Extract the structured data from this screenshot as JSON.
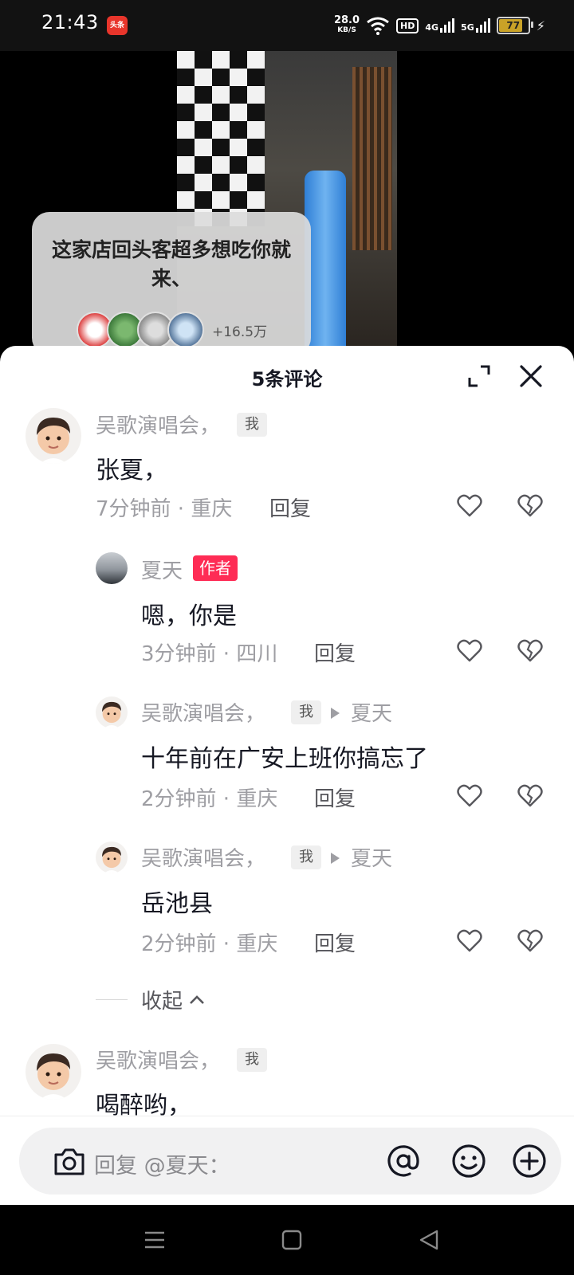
{
  "status_bar": {
    "time": "21:43",
    "app_badge": "头条",
    "net_speed": "28.0",
    "net_unit": "KB/S",
    "hd": "HD",
    "sig1": "4G",
    "sig2": "5G",
    "battery": "77",
    "battery_level": 0.77
  },
  "video": {
    "promo_text": "这家店回头客超多想吃你就来、",
    "promo_count": "+16.5万"
  },
  "sheet": {
    "title": "5条评论"
  },
  "comments": [
    {
      "user": "吴歌演唱会，",
      "badge": "我",
      "text": "张夏，",
      "meta": "7分钟前 · 重庆",
      "reply": "回复"
    },
    {
      "user": "夏天",
      "badge": "作者",
      "text": "嗯，你是",
      "meta": "3分钟前 · 四川",
      "reply": "回复"
    },
    {
      "user": "吴歌演唱会，",
      "badge": "我",
      "reply_to": "夏天",
      "text": "十年前在广安上班你搞忘了",
      "meta": "2分钟前 · 重庆",
      "reply": "回复"
    },
    {
      "user": "吴歌演唱会，",
      "badge": "我",
      "reply_to": "夏天",
      "text": "岳池县",
      "meta": "2分钟前 · 重庆",
      "reply": "回复"
    },
    {
      "user": "吴歌演唱会，",
      "badge": "我",
      "text": "喝醉哟，"
    }
  ],
  "collapse_label": "收起",
  "input": {
    "placeholder": "回复 @夏天："
  },
  "colors": {
    "accent": "#fe2c55",
    "muted_text": "#9e9ea3",
    "primary_text": "#161823"
  }
}
